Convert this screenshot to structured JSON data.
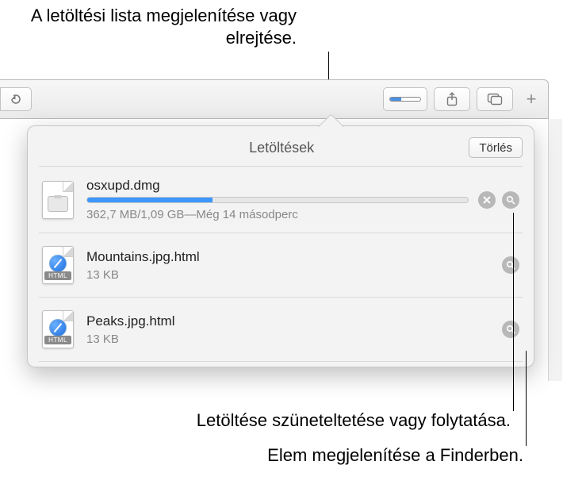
{
  "callouts": {
    "top": "A letöltési lista megjelenítése vagy elrejtése.",
    "pause": "Letöltése szüneteltetése vagy folytatása.",
    "reveal": "Elem megjelenítése a Finderben."
  },
  "toolbar": {
    "reload_icon": "reload-icon",
    "downloads_icon": "downloads-progress-icon",
    "share_icon": "share-icon",
    "tabs_icon": "tabs-icon",
    "newtab_icon": "plus-icon",
    "download_progress_fraction": 0.33
  },
  "popover": {
    "title": "Letöltések",
    "clear_label": "Törlés"
  },
  "downloads": [
    {
      "kind": "dmg",
      "name": "osxupd.dmg",
      "status": "362,7 MB/1,09 GB—Még 14 másodperc",
      "progress": 0.33,
      "in_progress": true
    },
    {
      "kind": "html",
      "name": "Mountains.jpg.html",
      "status": "13 KB",
      "in_progress": false
    },
    {
      "kind": "html",
      "name": "Peaks.jpg.html",
      "status": "13 KB",
      "in_progress": false
    }
  ],
  "badges": {
    "html": "HTML"
  }
}
